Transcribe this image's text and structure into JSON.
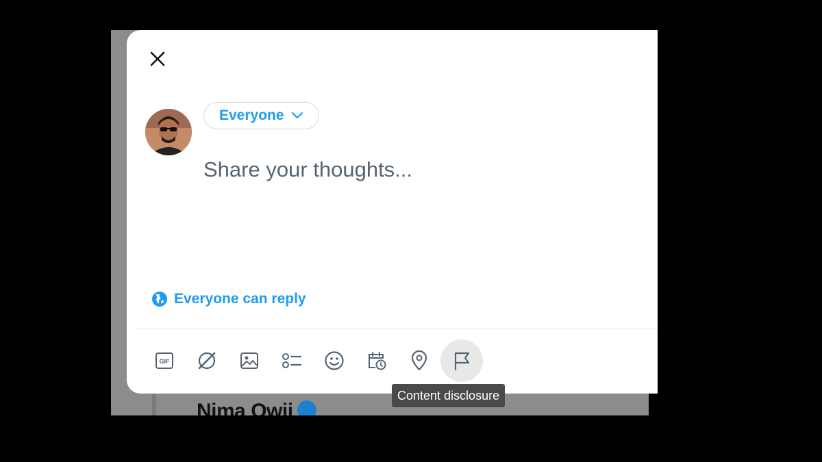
{
  "background": {
    "author_name": "Nima Owji"
  },
  "composer": {
    "close_icon": "close-icon",
    "audience_label": "Everyone",
    "placeholder": "Share your thoughts...",
    "reply_setting_label": "Everyone can reply",
    "toolbar": [
      {
        "icon": "gif-icon"
      },
      {
        "icon": "compose-circle-icon"
      },
      {
        "icon": "image-icon"
      },
      {
        "icon": "poll-list-icon"
      },
      {
        "icon": "emoji-icon"
      },
      {
        "icon": "schedule-icon"
      },
      {
        "icon": "location-icon"
      },
      {
        "icon": "flag-icon"
      }
    ],
    "tooltip": "Content disclosure"
  },
  "colors": {
    "accent": "#1d9bf0",
    "text_secondary": "#536471",
    "border": "#cfd9de"
  }
}
